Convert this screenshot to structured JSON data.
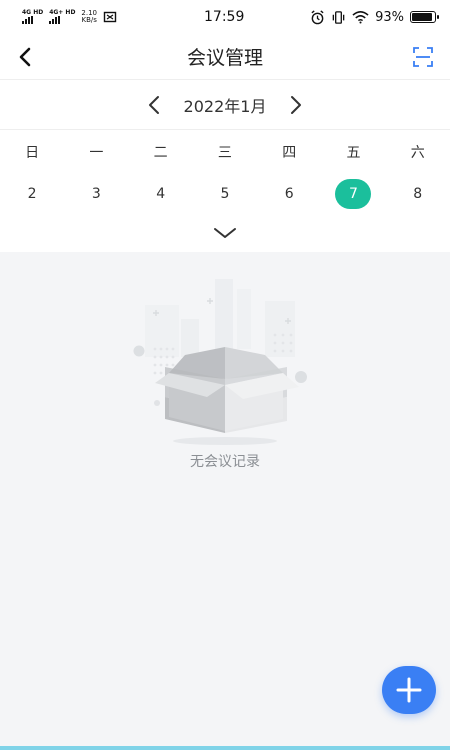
{
  "status_bar": {
    "signal1_tag": "4G HD",
    "signal2_tag": "4G+ HD",
    "net_speed_value": "2.10",
    "net_speed_unit": "KB/s",
    "time": "17:59",
    "battery": "93%",
    "battery_level": 0.93
  },
  "header": {
    "title": "会议管理",
    "back_icon": "chevron-left-icon",
    "scan_icon": "scan-icon"
  },
  "calendar": {
    "month_label": "2022年1月",
    "weekdays": [
      "日",
      "一",
      "二",
      "三",
      "四",
      "五",
      "六"
    ],
    "days": [
      "2",
      "3",
      "4",
      "5",
      "6",
      "7",
      "8"
    ],
    "selected_day": "7",
    "accent_color": "#1bbf9c"
  },
  "empty_state": {
    "message": "无会议记录",
    "icon": "empty-box-illustration"
  },
  "fab": {
    "icon": "plus-icon",
    "color": "#3a7ff4"
  }
}
